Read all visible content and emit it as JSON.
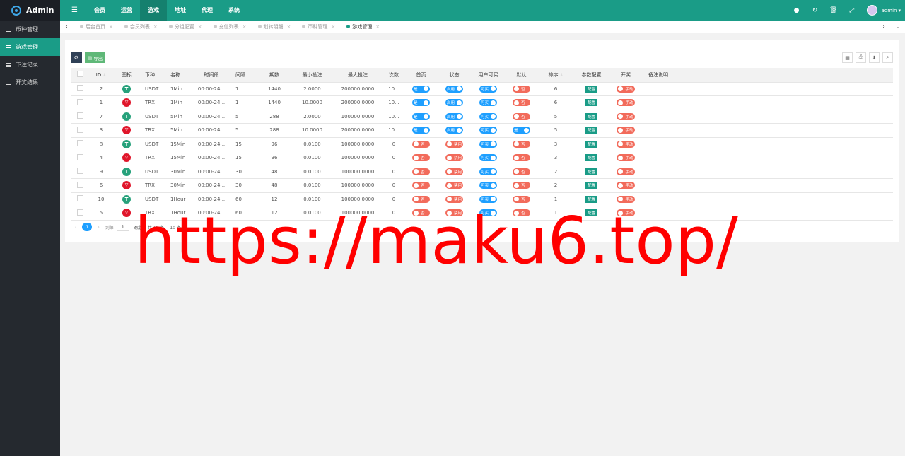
{
  "app": {
    "title": "Admin"
  },
  "topnav": {
    "menu_icon": "☰",
    "items": [
      "会员",
      "运营",
      "游戏",
      "地址",
      "代理",
      "系统"
    ],
    "active": "游戏"
  },
  "top_tools": [
    "●",
    "↻",
    "🗑",
    "⤢"
  ],
  "user": {
    "name": "admin",
    "caret": "▾"
  },
  "sidebar": {
    "items": [
      "币种管理",
      "游戏管理",
      "下注记录",
      "开奖结果"
    ],
    "active": "游戏管理"
  },
  "tabs": {
    "left_arrow": "‹",
    "right_arrow": "›",
    "down_arrow": "⌄",
    "items": [
      {
        "label": "后台首页",
        "active": false
      },
      {
        "label": "会员列表",
        "active": false
      },
      {
        "label": "分组配置",
        "active": false
      },
      {
        "label": "充值列表",
        "active": false
      },
      {
        "label": "划转明细",
        "active": false
      },
      {
        "label": "币种管理",
        "active": false
      },
      {
        "label": "游戏管理",
        "active": true
      }
    ],
    "close": "×"
  },
  "toolbar": {
    "refresh_icon": "⟳",
    "export_label": "导出"
  },
  "table": {
    "headers": [
      "ID",
      "图标",
      "币种",
      "名称",
      "时间段",
      "间隔",
      "期数",
      "最小投注",
      "最大投注",
      "次数",
      "首页",
      "状态",
      "用户可买",
      "默认",
      "排序",
      "参数配置",
      "开奖",
      "备注说明"
    ],
    "rows": [
      {
        "id": "2",
        "coin": "USDT",
        "name": "1Min",
        "period": "00:00-24...",
        "interval": "1",
        "issues": "1440",
        "min": "2.0000",
        "max": "200000.0000",
        "times": "10...",
        "home": "是",
        "status": "启用",
        "buy": "可买",
        "default": "否",
        "sort": "6",
        "config": "配置",
        "draw": "手动"
      },
      {
        "id": "1",
        "coin": "TRX",
        "name": "1Min",
        "period": "00:00-24...",
        "interval": "1",
        "issues": "1440",
        "min": "10.0000",
        "max": "200000.0000",
        "times": "10...",
        "home": "是",
        "status": "启用",
        "buy": "可买",
        "default": "否",
        "sort": "6",
        "config": "配置",
        "draw": "手动"
      },
      {
        "id": "7",
        "coin": "USDT",
        "name": "5Min",
        "period": "00:00-24...",
        "interval": "5",
        "issues": "288",
        "min": "2.0000",
        "max": "100000.0000",
        "times": "10...",
        "home": "是",
        "status": "启用",
        "buy": "可买",
        "default": "否",
        "sort": "5",
        "config": "配置",
        "draw": "手动"
      },
      {
        "id": "3",
        "coin": "TRX",
        "name": "5Min",
        "period": "00:00-24...",
        "interval": "5",
        "issues": "288",
        "min": "10.0000",
        "max": "200000.0000",
        "times": "10...",
        "home": "是",
        "status": "启用",
        "buy": "可买",
        "default": "是",
        "sort": "5",
        "config": "配置",
        "draw": "手动"
      },
      {
        "id": "8",
        "coin": "USDT",
        "name": "15Min",
        "period": "00:00-24...",
        "interval": "15",
        "issues": "96",
        "min": "0.0100",
        "max": "100000.0000",
        "times": "0",
        "home": "否",
        "status": "禁用",
        "buy": "可买",
        "default": "否",
        "sort": "3",
        "config": "配置",
        "draw": "手动"
      },
      {
        "id": "4",
        "coin": "TRX",
        "name": "15Min",
        "period": "00:00-24...",
        "interval": "15",
        "issues": "96",
        "min": "0.0100",
        "max": "100000.0000",
        "times": "0",
        "home": "否",
        "status": "禁用",
        "buy": "可买",
        "default": "否",
        "sort": "3",
        "config": "配置",
        "draw": "手动"
      },
      {
        "id": "9",
        "coin": "USDT",
        "name": "30Min",
        "period": "00:00-24...",
        "interval": "30",
        "issues": "48",
        "min": "0.0100",
        "max": "100000.0000",
        "times": "0",
        "home": "否",
        "status": "禁用",
        "buy": "可买",
        "default": "否",
        "sort": "2",
        "config": "配置",
        "draw": "手动"
      },
      {
        "id": "6",
        "coin": "TRX",
        "name": "30Min",
        "period": "00:00-24...",
        "interval": "30",
        "issues": "48",
        "min": "0.0100",
        "max": "100000.0000",
        "times": "0",
        "home": "否",
        "status": "禁用",
        "buy": "可买",
        "default": "否",
        "sort": "2",
        "config": "配置",
        "draw": "手动"
      },
      {
        "id": "10",
        "coin": "USDT",
        "name": "1Hour",
        "period": "00:00-24...",
        "interval": "60",
        "issues": "12",
        "min": "0.0100",
        "max": "100000.0000",
        "times": "0",
        "home": "否",
        "status": "禁用",
        "buy": "可买",
        "default": "否",
        "sort": "1",
        "config": "配置",
        "draw": "手动"
      },
      {
        "id": "5",
        "coin": "TRX",
        "name": "1Hour",
        "period": "00:00-24...",
        "interval": "60",
        "issues": "12",
        "min": "0.0100",
        "max": "100000.0000",
        "times": "0",
        "home": "否",
        "status": "禁用",
        "buy": "可买",
        "default": "否",
        "sort": "1",
        "config": "配置",
        "draw": "手动"
      }
    ]
  },
  "pager": {
    "prev": "‹",
    "current": "1",
    "next": "›",
    "goto_label": "到第",
    "page_value": "1",
    "confirm": "确定",
    "total": "共 10 条",
    "per_page": "10 条/页"
  },
  "watermark": "https://maku6.top/"
}
